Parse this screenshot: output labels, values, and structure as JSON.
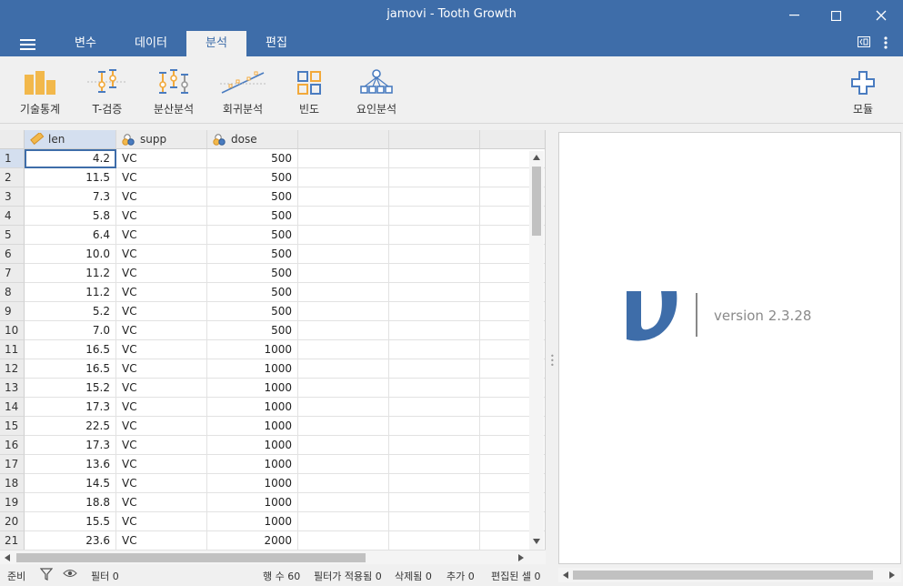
{
  "window": {
    "title": "jamovi - Tooth Growth",
    "minimize": "—",
    "maximize": "☐",
    "close": "✕"
  },
  "tabs": [
    {
      "label": "변수"
    },
    {
      "label": "데이터"
    },
    {
      "label": "분석"
    },
    {
      "label": "편집"
    }
  ],
  "active_tab": "분석",
  "ribbon": {
    "descriptives": "기술통계",
    "ttests": "T-검증",
    "anova": "분산분석",
    "regression": "회귀분석",
    "frequencies": "빈도",
    "factor": "요인분석",
    "modules": "모듈"
  },
  "colors": {
    "accent": "#3e6da9",
    "bar_icon": "#f2b84b",
    "scale_icon": "#f2a93b"
  },
  "columns": [
    {
      "name": "len",
      "type": "continuous",
      "icon": "ruler-icon"
    },
    {
      "name": "supp",
      "type": "nominal",
      "icon": "nominal-icon"
    },
    {
      "name": "dose",
      "type": "nominal",
      "icon": "nominal-icon"
    }
  ],
  "rows": [
    {
      "n": "1",
      "len": "4.2",
      "supp": "VC",
      "dose": "500"
    },
    {
      "n": "2",
      "len": "11.5",
      "supp": "VC",
      "dose": "500"
    },
    {
      "n": "3",
      "len": "7.3",
      "supp": "VC",
      "dose": "500"
    },
    {
      "n": "4",
      "len": "5.8",
      "supp": "VC",
      "dose": "500"
    },
    {
      "n": "5",
      "len": "6.4",
      "supp": "VC",
      "dose": "500"
    },
    {
      "n": "6",
      "len": "10.0",
      "supp": "VC",
      "dose": "500"
    },
    {
      "n": "7",
      "len": "11.2",
      "supp": "VC",
      "dose": "500"
    },
    {
      "n": "8",
      "len": "11.2",
      "supp": "VC",
      "dose": "500"
    },
    {
      "n": "9",
      "len": "5.2",
      "supp": "VC",
      "dose": "500"
    },
    {
      "n": "10",
      "len": "7.0",
      "supp": "VC",
      "dose": "500"
    },
    {
      "n": "11",
      "len": "16.5",
      "supp": "VC",
      "dose": "1000"
    },
    {
      "n": "12",
      "len": "16.5",
      "supp": "VC",
      "dose": "1000"
    },
    {
      "n": "13",
      "len": "15.2",
      "supp": "VC",
      "dose": "1000"
    },
    {
      "n": "14",
      "len": "17.3",
      "supp": "VC",
      "dose": "1000"
    },
    {
      "n": "15",
      "len": "22.5",
      "supp": "VC",
      "dose": "1000"
    },
    {
      "n": "16",
      "len": "17.3",
      "supp": "VC",
      "dose": "1000"
    },
    {
      "n": "17",
      "len": "13.6",
      "supp": "VC",
      "dose": "1000"
    },
    {
      "n": "18",
      "len": "14.5",
      "supp": "VC",
      "dose": "1000"
    },
    {
      "n": "19",
      "len": "18.8",
      "supp": "VC",
      "dose": "1000"
    },
    {
      "n": "20",
      "len": "15.5",
      "supp": "VC",
      "dose": "1000"
    },
    {
      "n": "21",
      "len": "23.6",
      "supp": "VC",
      "dose": "2000"
    }
  ],
  "results": {
    "version": "version 2.3.28"
  },
  "status": {
    "ready": "준비",
    "filter": "필터 0",
    "row_count": "행 수 60",
    "filtered": "필터가 적용됨 0",
    "deleted": "삭제됨 0",
    "added": "추가 0",
    "edited": "편집된 셀 0"
  }
}
